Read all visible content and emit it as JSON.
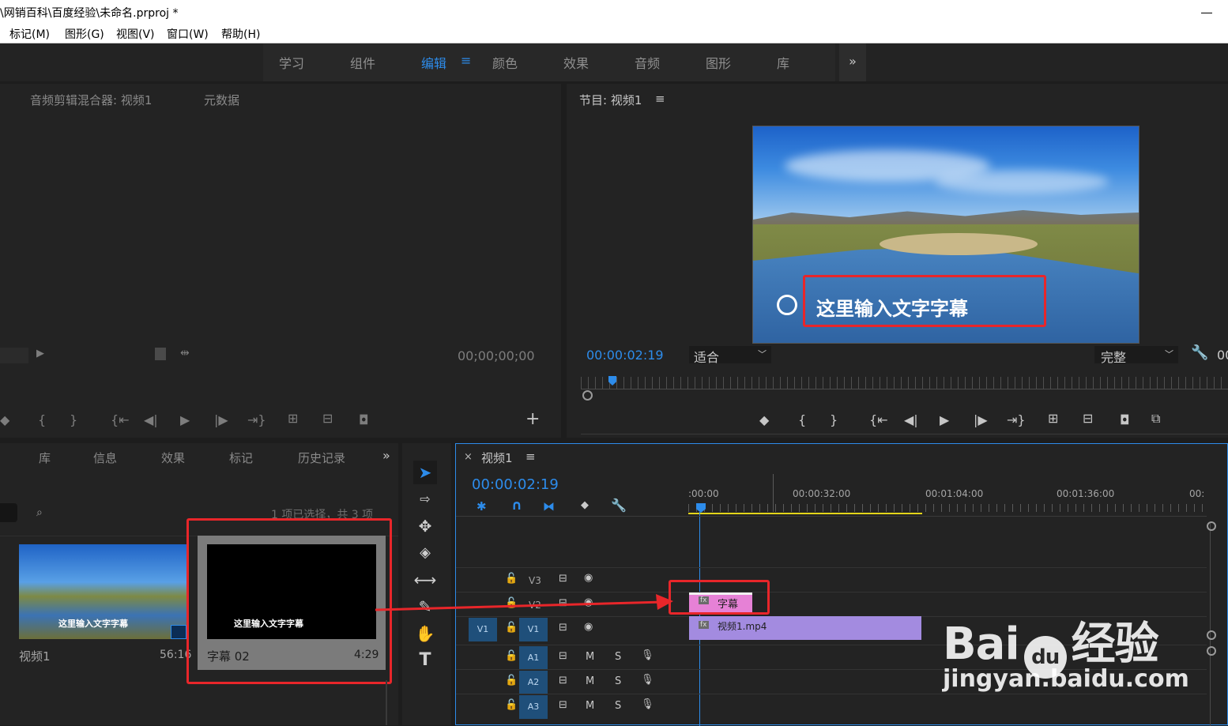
{
  "window": {
    "title": "\\网销百科\\百度经验\\未命名.prproj *"
  },
  "menu": [
    "标记(M)",
    "图形(G)",
    "视图(V)",
    "窗口(W)",
    "帮助(H)"
  ],
  "workspaces": {
    "tabs": [
      "学习",
      "组件",
      "编辑",
      "颜色",
      "效果",
      "音频",
      "图形",
      "库"
    ],
    "active": "编辑",
    "more": "»",
    "menu_icon": "≡"
  },
  "source_panel": {
    "tabs": [
      "音频剪辑混合器: 视频1",
      "元数据"
    ],
    "timecode": "00;00;00;00",
    "add": "+"
  },
  "program": {
    "title": "节目: 视频1",
    "menu_icon": "≡",
    "timecode": "00:00:02:19",
    "fit": "适合",
    "quality": "完整",
    "overlay_text": "这里输入文字字幕",
    "cut_off": "00"
  },
  "project_panel": {
    "tabs": [
      "库",
      "信息",
      "效果",
      "标记",
      "历史记录"
    ],
    "more": "»",
    "status": "1 项已选择，共 3 项",
    "items": [
      {
        "name": "视频1",
        "duration": "56:16",
        "overlay": "这里输入文字字幕"
      },
      {
        "name": "字幕 02",
        "duration": "4:29",
        "overlay": "这里输入文字字幕"
      }
    ]
  },
  "timeline": {
    "title": "视频1",
    "close": "×",
    "menu_icon": "≡",
    "timecode": "00:00:02:19",
    "ruler": [
      ":00:00",
      "00:00:32:00",
      "00:01:04:00",
      "00:01:36:00",
      "00:"
    ],
    "tracks": [
      {
        "label": "V3"
      },
      {
        "label": "V2"
      },
      {
        "label": "V1",
        "source": "V1"
      },
      {
        "label": "A1",
        "m": "M",
        "s": "S"
      },
      {
        "label": "A2",
        "m": "M",
        "s": "S"
      },
      {
        "label": "A3",
        "m": "M",
        "s": "S"
      }
    ],
    "clips": [
      {
        "label": "字幕",
        "fx": "fx",
        "track": "V2",
        "color": "#e681d6"
      },
      {
        "label": "视频1.mp4",
        "fx": "fx",
        "track": "V1",
        "color": "#a38be0"
      }
    ]
  },
  "watermark": {
    "brand": "Bai",
    "brand2": "du",
    "brand3": "经验",
    "url": "jingyan.baidu.com"
  }
}
